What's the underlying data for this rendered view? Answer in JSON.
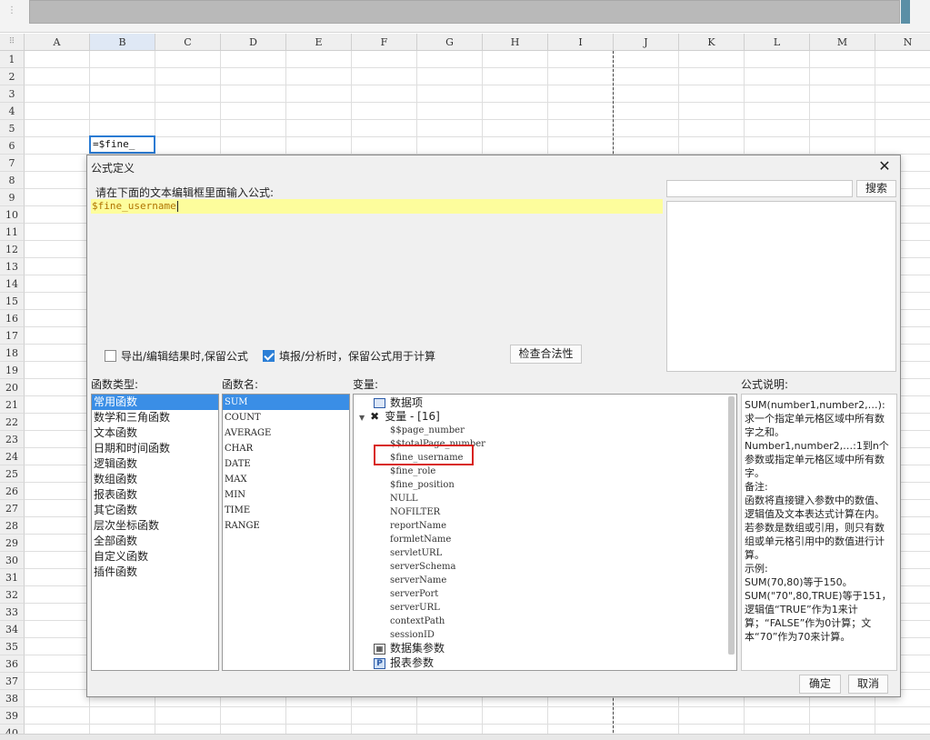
{
  "sheet": {
    "columns": [
      "A",
      "B",
      "C",
      "D",
      "E",
      "F",
      "G",
      "H",
      "I",
      "J",
      "K",
      "L",
      "M",
      "N"
    ],
    "selected_column": "B",
    "rows": [
      "1",
      "2",
      "3",
      "4",
      "5",
      "6",
      "7",
      "8",
      "9",
      "10",
      "11",
      "12",
      "13",
      "14",
      "15",
      "16",
      "17",
      "18",
      "19",
      "20",
      "21",
      "22",
      "23",
      "24",
      "25",
      "26",
      "27",
      "28",
      "29",
      "30",
      "31",
      "32",
      "33",
      "34",
      "35",
      "36",
      "37",
      "38",
      "39",
      "40"
    ],
    "active_cell_value": "=$fine_"
  },
  "dialog": {
    "title": "公式定义",
    "prompt": "请在下面的文本编辑框里面输入公式:",
    "formula": "$fine_username",
    "search_placeholder": "",
    "search_label": "搜索",
    "checkbox_export": "导出/编辑结果时,保留公式",
    "checkbox_fill": "填报/分析时，保留公式用于计算",
    "check_validity_label": "检查合法性",
    "func_type_label": "函数类型:",
    "func_name_label": "函数名:",
    "variables_label": "变量:",
    "formula_desc_label": "公式说明:",
    "ok_label": "确定",
    "cancel_label": "取消",
    "function_types": [
      "常用函数",
      "数学和三角函数",
      "文本函数",
      "日期和时间函数",
      "逻辑函数",
      "数组函数",
      "报表函数",
      "其它函数",
      "层次坐标函数",
      "全部函数",
      "自定义函数",
      "插件函数"
    ],
    "function_names": [
      "SUM",
      "COUNT",
      "AVERAGE",
      "CHAR",
      "DATE",
      "MAX",
      "MIN",
      "TIME",
      "RANGE"
    ],
    "variables": {
      "data_items": "数据项",
      "variables_node": "变量 - [16]",
      "leaves": [
        "$$page_number",
        "$$totalPage_number",
        "$fine_username",
        "$fine_role",
        "$fine_position",
        "NULL",
        "NOFILTER",
        "reportName",
        "formletName",
        "servletURL",
        "serverSchema",
        "serverName",
        "serverPort",
        "serverURL",
        "contextPath",
        "sessionID"
      ],
      "dataset_params": "数据集参数",
      "report_params": "报表参数"
    },
    "description_lines": [
      "SUM(number1,number2,…):求一个指定单元格区域中所有数字之和。",
      "Number1,number2,…:1到n个参数或指定单元格区域中所有数字。",
      "备注:",
      "函数将直接键入参数中的数值、逻辑值及文本表达式计算在内。若参数是数组或引用，则只有数组或单元格引用中的数值进行计算。",
      "示例:",
      "SUM(70,80)等于150。",
      "SUM(\"70\",80,TRUE)等于151，逻辑值“TRUE”作为1来计算；“FALSE”作为0计算；文本“70”作为70来计算。"
    ]
  },
  "colors": {
    "selection": "#3a8ee6",
    "formula_highlight": "#fdfd9c",
    "annotation_red": "#d8231c",
    "active_cell_border": "#2a7bd3"
  }
}
